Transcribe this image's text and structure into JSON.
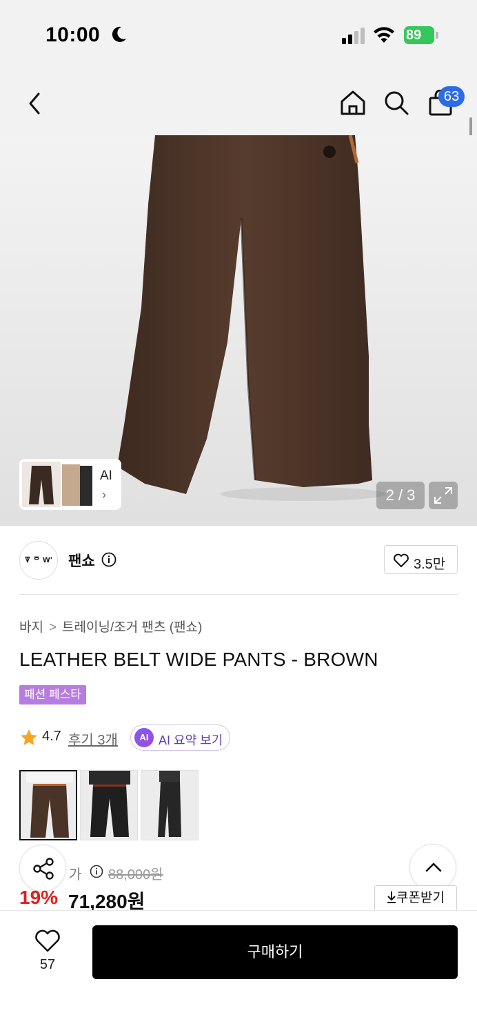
{
  "status_bar": {
    "time": "10:00",
    "battery": "89"
  },
  "nav": {
    "cart_count": "63",
    "icons": [
      "back-icon",
      "home-icon",
      "search-icon",
      "shopping-bag-icon"
    ]
  },
  "gallery": {
    "counter": "2 / 3",
    "ai_label": "AI",
    "ai_chevron": "›"
  },
  "brand": {
    "logo_text": "ꘜ ᅙ W'",
    "name": "팬쇼",
    "likes": "3.5만"
  },
  "breadcrumb": {
    "level1": "바지",
    "separator": ">",
    "level2": "트레이닝/조거 팬츠 (팬쇼)"
  },
  "product": {
    "title": "LEATHER BELT WIDE PANTS - BROWN",
    "tag": "패션 페스타",
    "rating": "4.7",
    "reviews": "후기 3개",
    "ai_badge": "AI",
    "ai_summary": "AI 요약 보기"
  },
  "price": {
    "original_label": "정가",
    "original_label_visible": "가",
    "original": "88,000원",
    "discount": "19%",
    "sale": "71,280원",
    "coupon": "쿠폰받기"
  },
  "bottom_bar": {
    "like_count": "57",
    "buy_label": "구매하기"
  },
  "colors": {
    "accent_blue": "#2e6be6",
    "discount_red": "#e02020",
    "tag_purple": "#b77ce0",
    "product_brown": "#4a3327"
  }
}
